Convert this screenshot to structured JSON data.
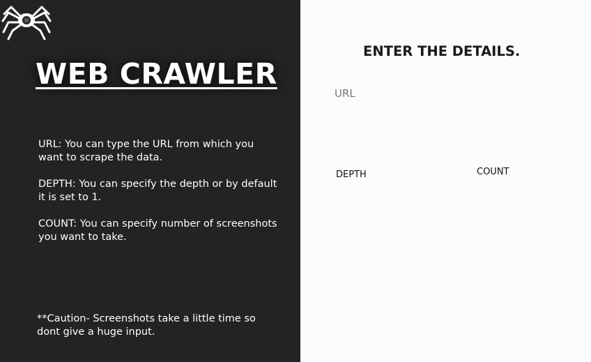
{
  "brand": {
    "logo_icon": "spider-icon",
    "title": "WEB CRAWLER"
  },
  "instructions": {
    "url": "URL: You can type the URL from which you want to scrape the data.",
    "depth": "DEPTH: You can specify the depth or by default it is set to 1.",
    "count": "COUNT: You can specify number of screenshots you want to take.",
    "caution": "**Caution- Screenshots take a little time so dont give a huge input."
  },
  "form": {
    "heading": "ENTER THE DETAILS.",
    "url": {
      "label": "URL",
      "value": ""
    },
    "depth": {
      "label": "DEPTH",
      "value": ""
    },
    "count": {
      "label": "COUNT",
      "value": ""
    }
  },
  "colors": {
    "left_panel_bg": "#232323",
    "right_panel_bg": "#fcfcfc",
    "title_text": "#ffffff",
    "heading_text": "#1a1a1a",
    "url_label_text": "#777777"
  }
}
